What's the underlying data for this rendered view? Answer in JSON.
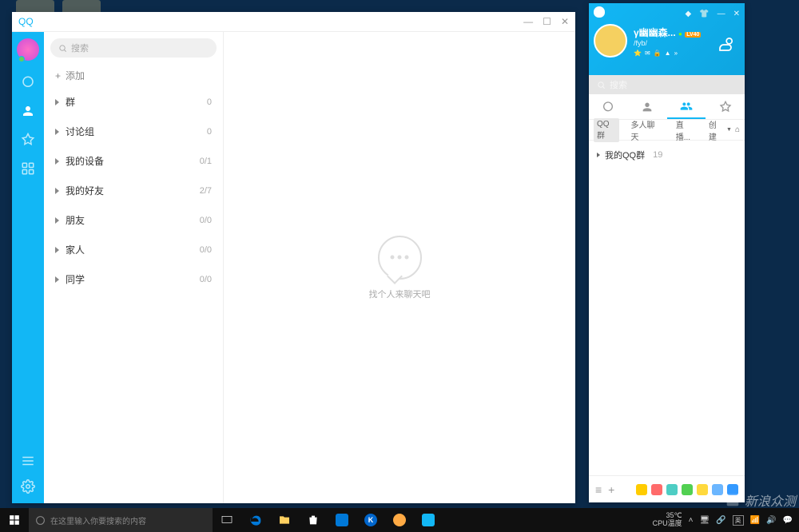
{
  "qqMain": {
    "title": "QQ",
    "searchPlaceholder": "搜索",
    "addLabel": "添加",
    "groups": [
      {
        "name": "群",
        "count": "0"
      },
      {
        "name": "讨论组",
        "count": "0"
      },
      {
        "name": "我的设备",
        "count": "0/1"
      },
      {
        "name": "我的好友",
        "count": "2/7"
      },
      {
        "name": "朋友",
        "count": "0/0"
      },
      {
        "name": "家人",
        "count": "0/0"
      },
      {
        "name": "同学",
        "count": "0/0"
      }
    ],
    "emptyText": "找个人来聊天吧"
  },
  "qqMini": {
    "username": "γ幽幽森...",
    "subname": "/fyb/",
    "searchPlaceholder": "搜索",
    "subtabs": {
      "groups": "QQ群",
      "multi": "多人聊天",
      "live": "直播...",
      "create": "创建"
    },
    "list": {
      "myGroups": "我的QQ群",
      "myGroupsCount": "19"
    }
  },
  "taskbar": {
    "cortana": "在这里输入你要搜索的内容",
    "temp": "35℃",
    "tempLabel": "CPU温度"
  },
  "watermark": "新浪众测"
}
